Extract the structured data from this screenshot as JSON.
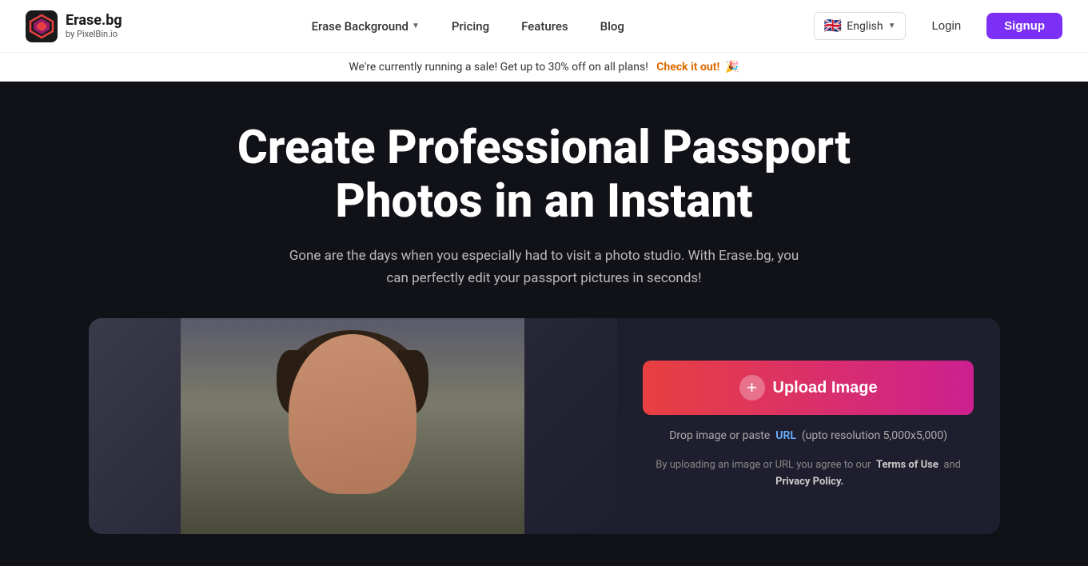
{
  "navbar": {
    "logo_title": "Erase.bg",
    "logo_subtitle": "by PixelBin.io",
    "nav_items": [
      {
        "label": "Erase Background",
        "has_dropdown": true
      },
      {
        "label": "Pricing",
        "has_dropdown": false
      },
      {
        "label": "Features",
        "has_dropdown": false
      },
      {
        "label": "Blog",
        "has_dropdown": false
      }
    ],
    "lang_label": "English",
    "lang_flag": "🇬🇧",
    "login_label": "Login",
    "signup_label": "Signup"
  },
  "sale_banner": {
    "text": "We're currently running a sale! Get up to 30% off on all plans!",
    "cta_text": "Check it out!",
    "emoji": "🎉"
  },
  "hero": {
    "title": "Create Professional Passport Photos in an Instant",
    "subtitle": "Gone are the days when you especially had to visit a photo studio. With Erase.bg, you can perfectly edit your passport pictures in seconds!"
  },
  "upload": {
    "button_label": "Upload Image",
    "hint_text": "Drop image or paste",
    "hint_link": "URL",
    "hint_resolution": "(upto resolution 5,000x5,000)",
    "terms_prefix": "By uploading an image or URL you agree to our",
    "terms_link1": "Terms of Use",
    "terms_and": "and",
    "terms_link2": "Privacy Policy."
  },
  "icons": {
    "upload_plus": "+"
  },
  "colors": {
    "upload_gradient_start": "#e84040",
    "upload_gradient_end": "#cc2090",
    "signup_bg": "#7b2ff7",
    "accent_link": "#e06b00"
  }
}
